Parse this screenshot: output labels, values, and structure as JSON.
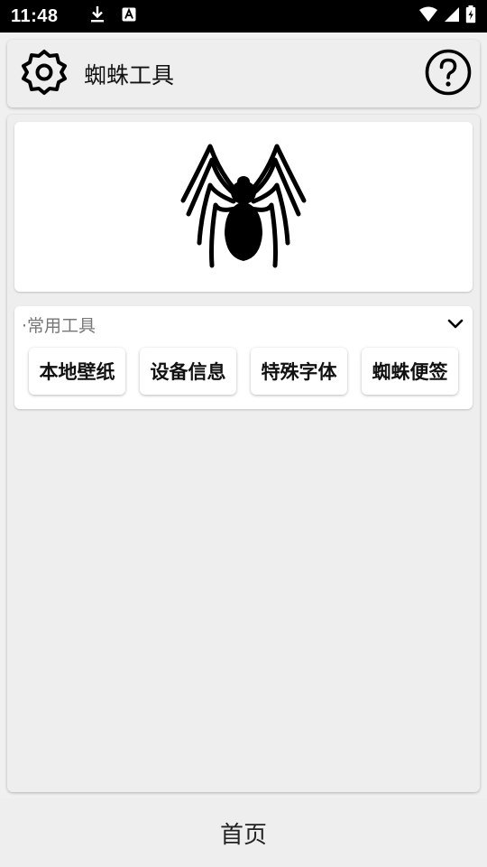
{
  "status_bar": {
    "time": "11:48",
    "left_icons": [
      "download-icon",
      "font-a-icon"
    ],
    "right_icons": [
      "wifi-icon",
      "signal-icon",
      "battery-charging-icon"
    ]
  },
  "header": {
    "title": "蜘蛛工具",
    "left_icon": "gear-icon",
    "right_icon": "help-circle-icon"
  },
  "banner": {
    "icon": "spider-icon"
  },
  "tools": {
    "title": "·常用工具",
    "toggle_icon": "chevron-down-icon",
    "items": [
      {
        "label": "本地壁纸"
      },
      {
        "label": "设备信息"
      },
      {
        "label": "特殊字体"
      },
      {
        "label": "蜘蛛便签"
      }
    ]
  },
  "bottom_nav": {
    "home_label": "首页"
  },
  "colors": {
    "status_bar_bg": "#000000",
    "page_bg": "#f0f0f0",
    "card_bg": "#ffffff",
    "panel_bg": "#eeeeee",
    "muted_text": "#777777"
  }
}
